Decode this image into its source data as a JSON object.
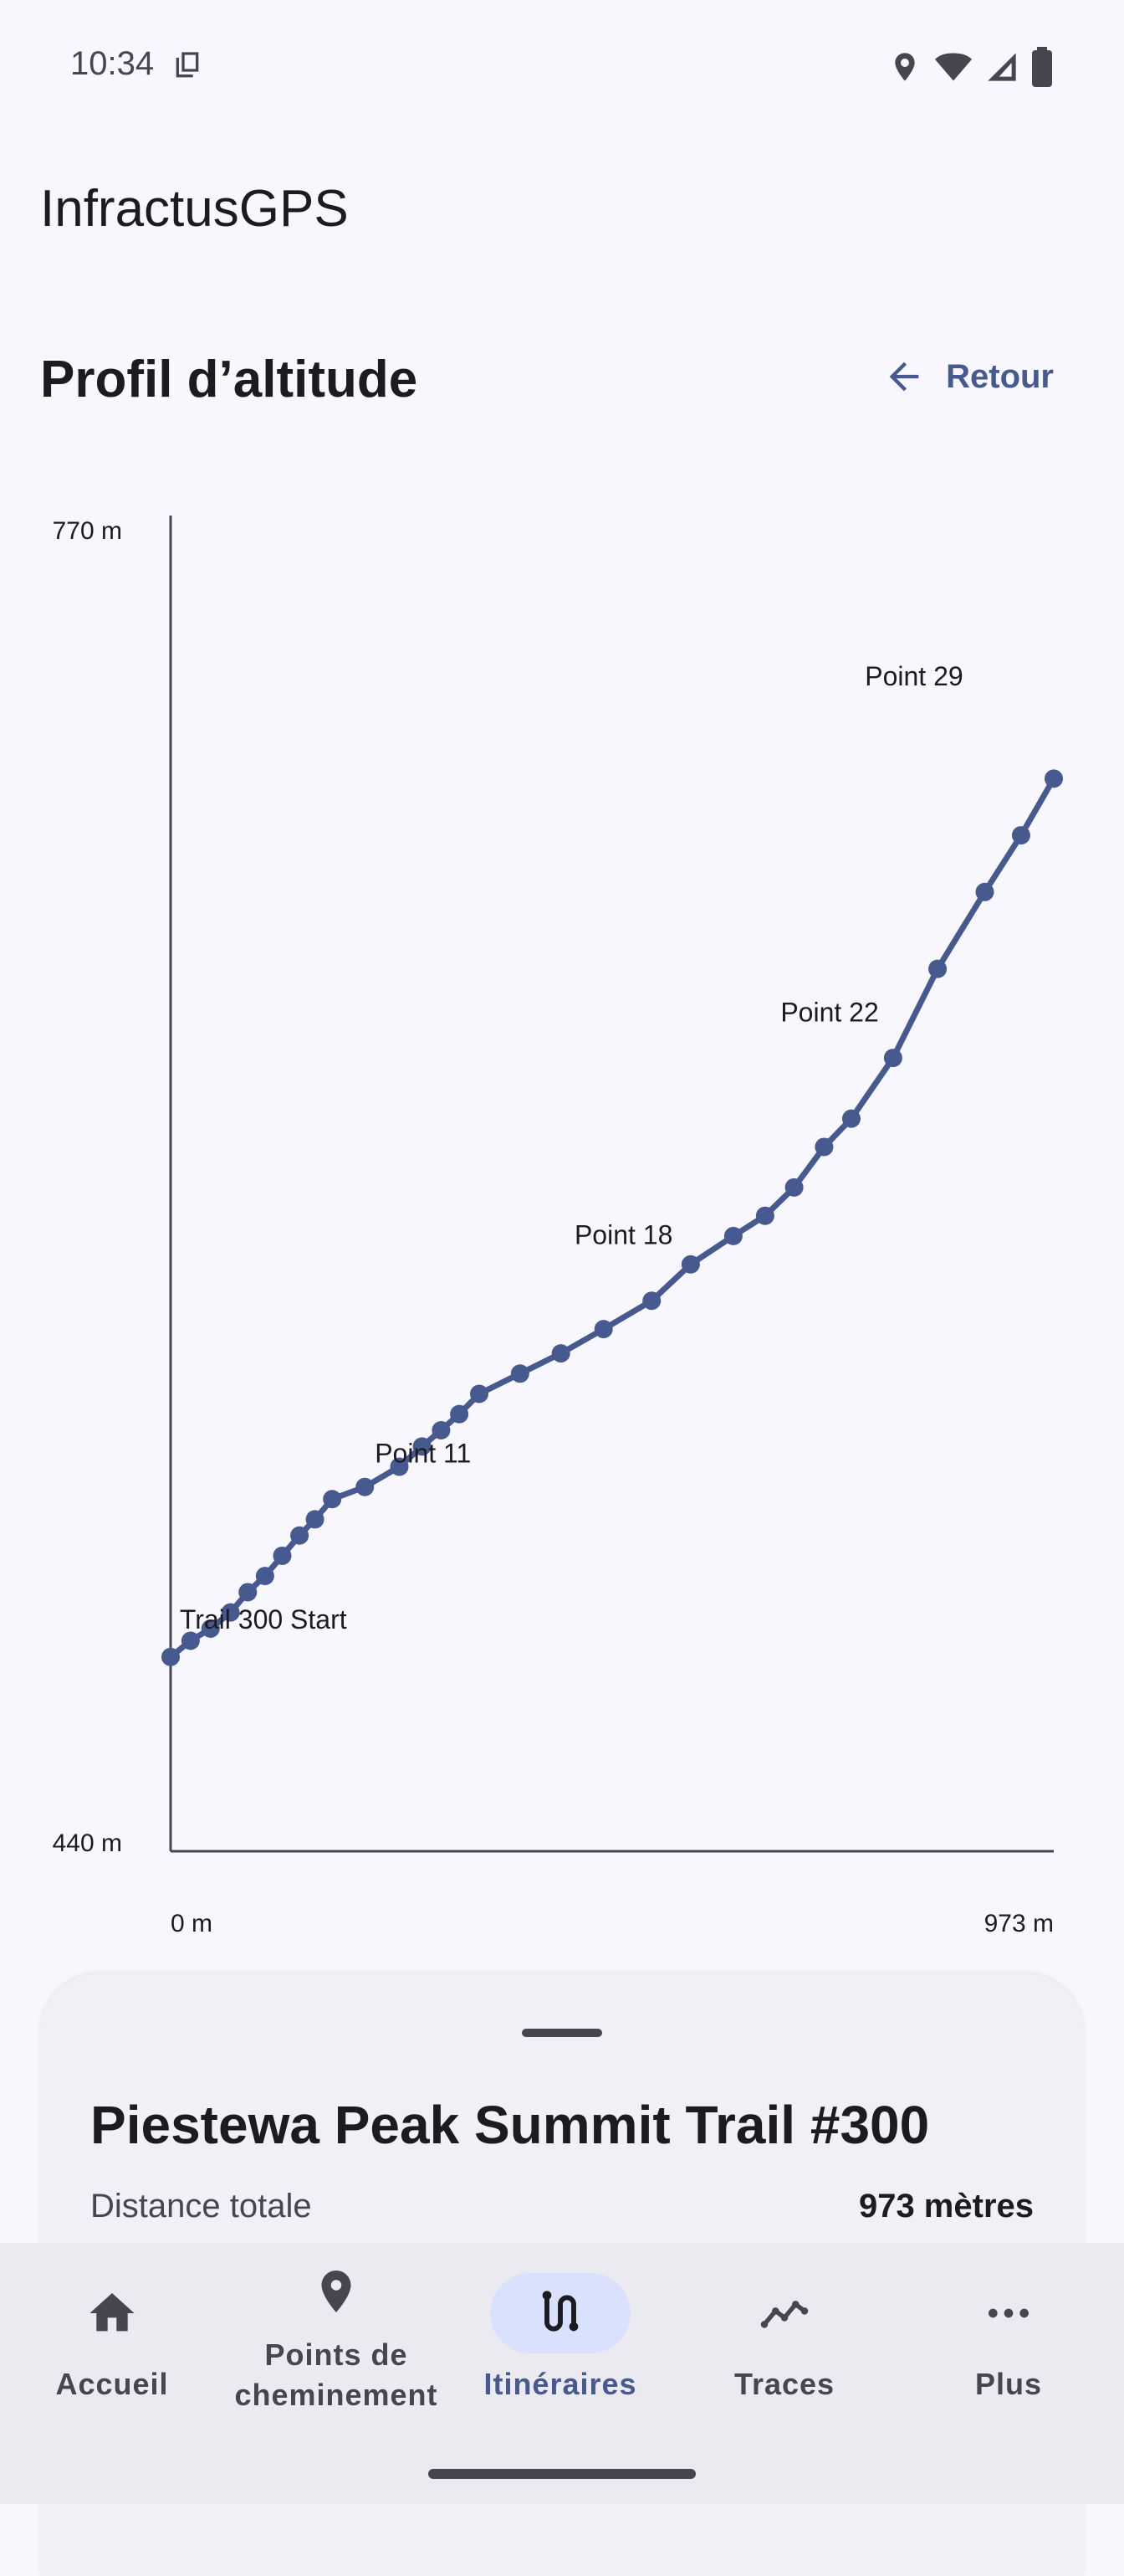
{
  "status_bar": {
    "time": "10:34"
  },
  "app": {
    "title": "InfractusGPS"
  },
  "header": {
    "title": "Profil d’altitude",
    "back_label": "Retour"
  },
  "chart_data": {
    "type": "line",
    "y_axis": {
      "min_label": "440 m",
      "max_label": "770 m",
      "range": [
        440,
        770
      ]
    },
    "x_axis": {
      "min_label": "0 m",
      "max_label": "973 m",
      "range": [
        0,
        973
      ]
    },
    "series": [
      {
        "color": "#465a8f",
        "points": [
          [
            0,
            488
          ],
          [
            22,
            492
          ],
          [
            44,
            495
          ],
          [
            66,
            499
          ],
          [
            85,
            504
          ],
          [
            104,
            508
          ],
          [
            123,
            513
          ],
          [
            142,
            518
          ],
          [
            159,
            522
          ],
          [
            178,
            527
          ],
          [
            214,
            530
          ],
          [
            252,
            535
          ],
          [
            277,
            540
          ],
          [
            298,
            544
          ],
          [
            318,
            548
          ],
          [
            340,
            553
          ],
          [
            385,
            558
          ],
          [
            430,
            563
          ],
          [
            477,
            569
          ],
          [
            530,
            576
          ],
          [
            573,
            585
          ],
          [
            620,
            592
          ],
          [
            655,
            597
          ],
          [
            687,
            604
          ],
          [
            720,
            614
          ],
          [
            750,
            621
          ],
          [
            796,
            636
          ],
          [
            845,
            658
          ],
          [
            897,
            677
          ],
          [
            937,
            691
          ],
          [
            973,
            705
          ]
        ]
      }
    ],
    "annotations": [
      {
        "text": "Trail 300 Start",
        "x": 10,
        "y": 495
      },
      {
        "text": "Point 11",
        "x": 225,
        "y": 536
      },
      {
        "text": "Point 18",
        "x": 445,
        "y": 590
      },
      {
        "text": "Point 22",
        "x": 672,
        "y": 645
      },
      {
        "text": "Point 29",
        "x": 765,
        "y": 728
      }
    ],
    "grid": false
  },
  "route": {
    "name": "Piestewa Peak Summit Trail #300",
    "distance_label": "Distance totale",
    "distance_value": "973 mètres"
  },
  "nav": {
    "items": [
      {
        "label": "Accueil",
        "icon": "home-icon"
      },
      {
        "label": "Points de cheminement",
        "icon": "location-pin-icon"
      },
      {
        "label": "Itinéraires",
        "icon": "route-icon",
        "active": true
      },
      {
        "label": "Traces",
        "icon": "trace-icon"
      },
      {
        "label": "Plus",
        "icon": "more-icon"
      }
    ]
  }
}
